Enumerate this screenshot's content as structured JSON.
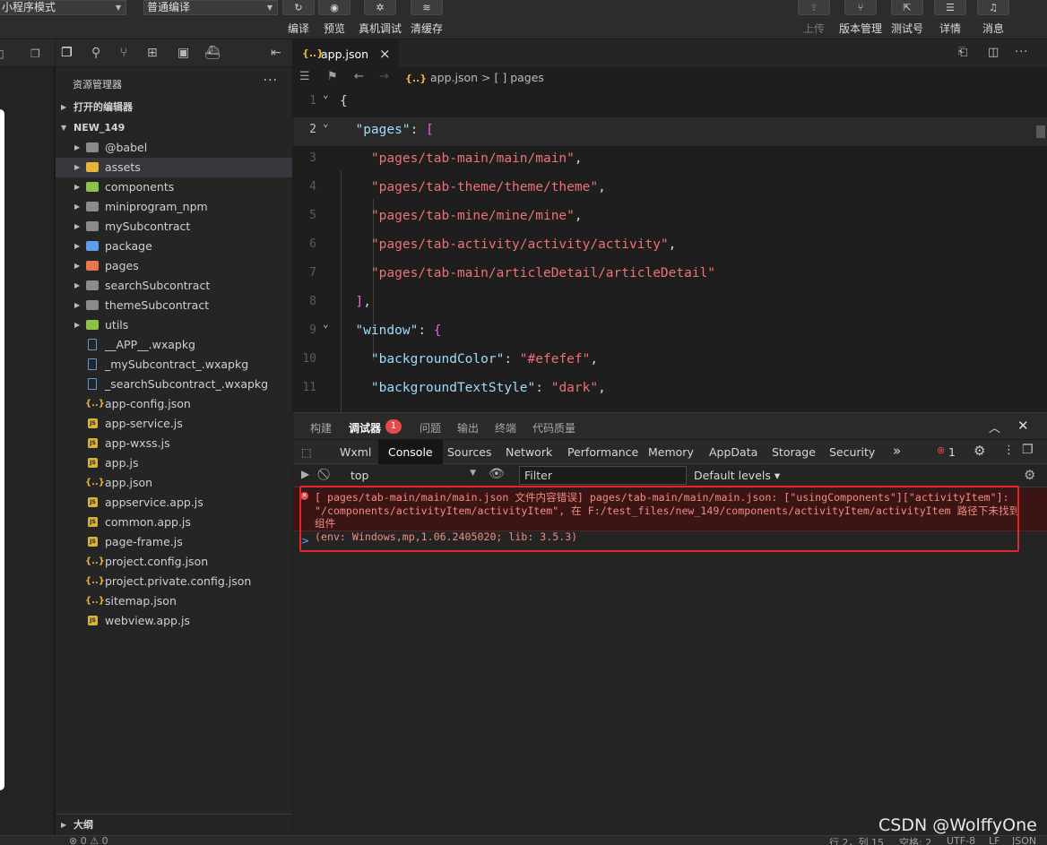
{
  "toolbar": {
    "mode_select": "小程序模式",
    "compile_select": "普通编译",
    "buttons": [
      {
        "label": "编译",
        "icon": "↻"
      },
      {
        "label": "预览",
        "icon": "◉"
      },
      {
        "label": "真机调试",
        "icon": "✲"
      },
      {
        "label": "清缓存",
        "icon": "≋"
      }
    ],
    "right_buttons": [
      {
        "label": "上传",
        "icon": "⇪"
      },
      {
        "label": "版本管理",
        "icon": "⑂"
      },
      {
        "label": "测试号",
        "icon": "⇱"
      },
      {
        "label": "详情",
        "icon": "☰"
      },
      {
        "label": "消息",
        "icon": "♫"
      }
    ]
  },
  "explorer": {
    "title": "资源管理器",
    "more": "···",
    "open_editors": "打开的编辑器",
    "project": "NEW_149",
    "items": [
      {
        "name": "@babel",
        "type": "folder",
        "color": "gray"
      },
      {
        "name": "assets",
        "type": "folder",
        "color": "yellow"
      },
      {
        "name": "components",
        "type": "folder",
        "color": "green"
      },
      {
        "name": "miniprogram_npm",
        "type": "folder",
        "color": "gray"
      },
      {
        "name": "mySubcontract",
        "type": "folder",
        "color": "gray"
      },
      {
        "name": "package",
        "type": "folder",
        "color": "blue"
      },
      {
        "name": "pages",
        "type": "folder",
        "color": "red"
      },
      {
        "name": "searchSubcontract",
        "type": "folder",
        "color": "gray"
      },
      {
        "name": "themeSubcontract",
        "type": "folder",
        "color": "gray"
      },
      {
        "name": "utils",
        "type": "folder",
        "color": "green"
      },
      {
        "name": "__APP__.wxapkg",
        "type": "doc"
      },
      {
        "name": "_mySubcontract_.wxapkg",
        "type": "doc"
      },
      {
        "name": "_searchSubcontract_.wxapkg",
        "type": "doc"
      },
      {
        "name": "app-config.json",
        "type": "json"
      },
      {
        "name": "app-service.js",
        "type": "js"
      },
      {
        "name": "app-wxss.js",
        "type": "js"
      },
      {
        "name": "app.js",
        "type": "js"
      },
      {
        "name": "app.json",
        "type": "json"
      },
      {
        "name": "appservice.app.js",
        "type": "js"
      },
      {
        "name": "common.app.js",
        "type": "js"
      },
      {
        "name": "page-frame.js",
        "type": "js"
      },
      {
        "name": "project.config.json",
        "type": "json"
      },
      {
        "name": "project.private.config.json",
        "type": "json"
      },
      {
        "name": "sitemap.json",
        "type": "json"
      },
      {
        "name": "webview.app.js",
        "type": "js"
      }
    ],
    "outline": "大纲"
  },
  "editor": {
    "tab_icon": "{..}",
    "tab_name": "app.json",
    "tab_close": "×",
    "breadcrumb_file": "app.json",
    "breadcrumb_sep": " > ",
    "breadcrumb_node": "[ ] pages",
    "lines": [
      {
        "n": "1",
        "parts": [
          {
            "c": "p",
            "t": "{"
          }
        ]
      },
      {
        "n": "2",
        "parts": [
          {
            "c": "k",
            "t": "  \"pages\""
          },
          {
            "c": "p",
            "t": ": "
          },
          {
            "c": "b2",
            "t": "["
          }
        ]
      },
      {
        "n": "3",
        "parts": [
          {
            "c": "s",
            "t": "    \"pages/tab-main/main/main\""
          },
          {
            "c": "p",
            "t": ","
          }
        ]
      },
      {
        "n": "4",
        "parts": [
          {
            "c": "s",
            "t": "    \"pages/tab-theme/theme/theme\""
          },
          {
            "c": "p",
            "t": ","
          }
        ]
      },
      {
        "n": "5",
        "parts": [
          {
            "c": "s",
            "t": "    \"pages/tab-mine/mine/mine\""
          },
          {
            "c": "p",
            "t": ","
          }
        ]
      },
      {
        "n": "6",
        "parts": [
          {
            "c": "s",
            "t": "    \"pages/tab-activity/activity/activity\""
          },
          {
            "c": "p",
            "t": ","
          }
        ]
      },
      {
        "n": "7",
        "parts": [
          {
            "c": "s",
            "t": "    \"pages/tab-main/articleDetail/articleDetail\""
          }
        ]
      },
      {
        "n": "8",
        "parts": [
          {
            "c": "b2",
            "t": "  ]"
          },
          {
            "c": "p",
            "t": ","
          }
        ]
      },
      {
        "n": "9",
        "parts": [
          {
            "c": "k",
            "t": "  \"window\""
          },
          {
            "c": "p",
            "t": ": "
          },
          {
            "c": "b2",
            "t": "{"
          }
        ]
      },
      {
        "n": "10",
        "parts": [
          {
            "c": "k",
            "t": "    \"backgroundColor\""
          },
          {
            "c": "p",
            "t": ": "
          },
          {
            "c": "s",
            "t": "\"#efefef\""
          },
          {
            "c": "p",
            "t": ","
          }
        ]
      },
      {
        "n": "11",
        "parts": [
          {
            "c": "k",
            "t": "    \"backgroundTextStyle\""
          },
          {
            "c": "p",
            "t": ": "
          },
          {
            "c": "s",
            "t": "\"dark\""
          },
          {
            "c": "p",
            "t": ","
          }
        ]
      }
    ]
  },
  "devtools": {
    "top_tabs": [
      "构建",
      "调试器",
      "问题",
      "输出",
      "终端",
      "代码质量"
    ],
    "debugger_badge": "1",
    "panel_tabs": [
      "Wxml",
      "Console",
      "Sources",
      "Network",
      "Performance",
      "Memory",
      "AppData",
      "Storage",
      "Security"
    ],
    "more_tabs": "»",
    "error_count": "1",
    "context": "top",
    "filter_placeholder": "Filter",
    "levels": "Default levels ▾",
    "error_text": "[ pages/tab-main/main/main.json 文件内容错误] pages/tab-main/main/main.json: [\"usingComponents\"][\"activityItem\"]: \"/components/activityItem/activityItem\", 在 F:/test_files/new_149/components/activityItem/activityItem 路径下未找到组件\n(env: Windows,mp,1.06.2405020; lib: 3.5.3)",
    "prompt": ">"
  },
  "status": {
    "problems": "⊗ 0 ⚠ 0",
    "position": "行 2，列 15",
    "spaces": "空格: 2",
    "encoding": "UTF-8",
    "eol": "LF",
    "language": "JSON"
  },
  "watermark": "CSDN @WolffyOne"
}
